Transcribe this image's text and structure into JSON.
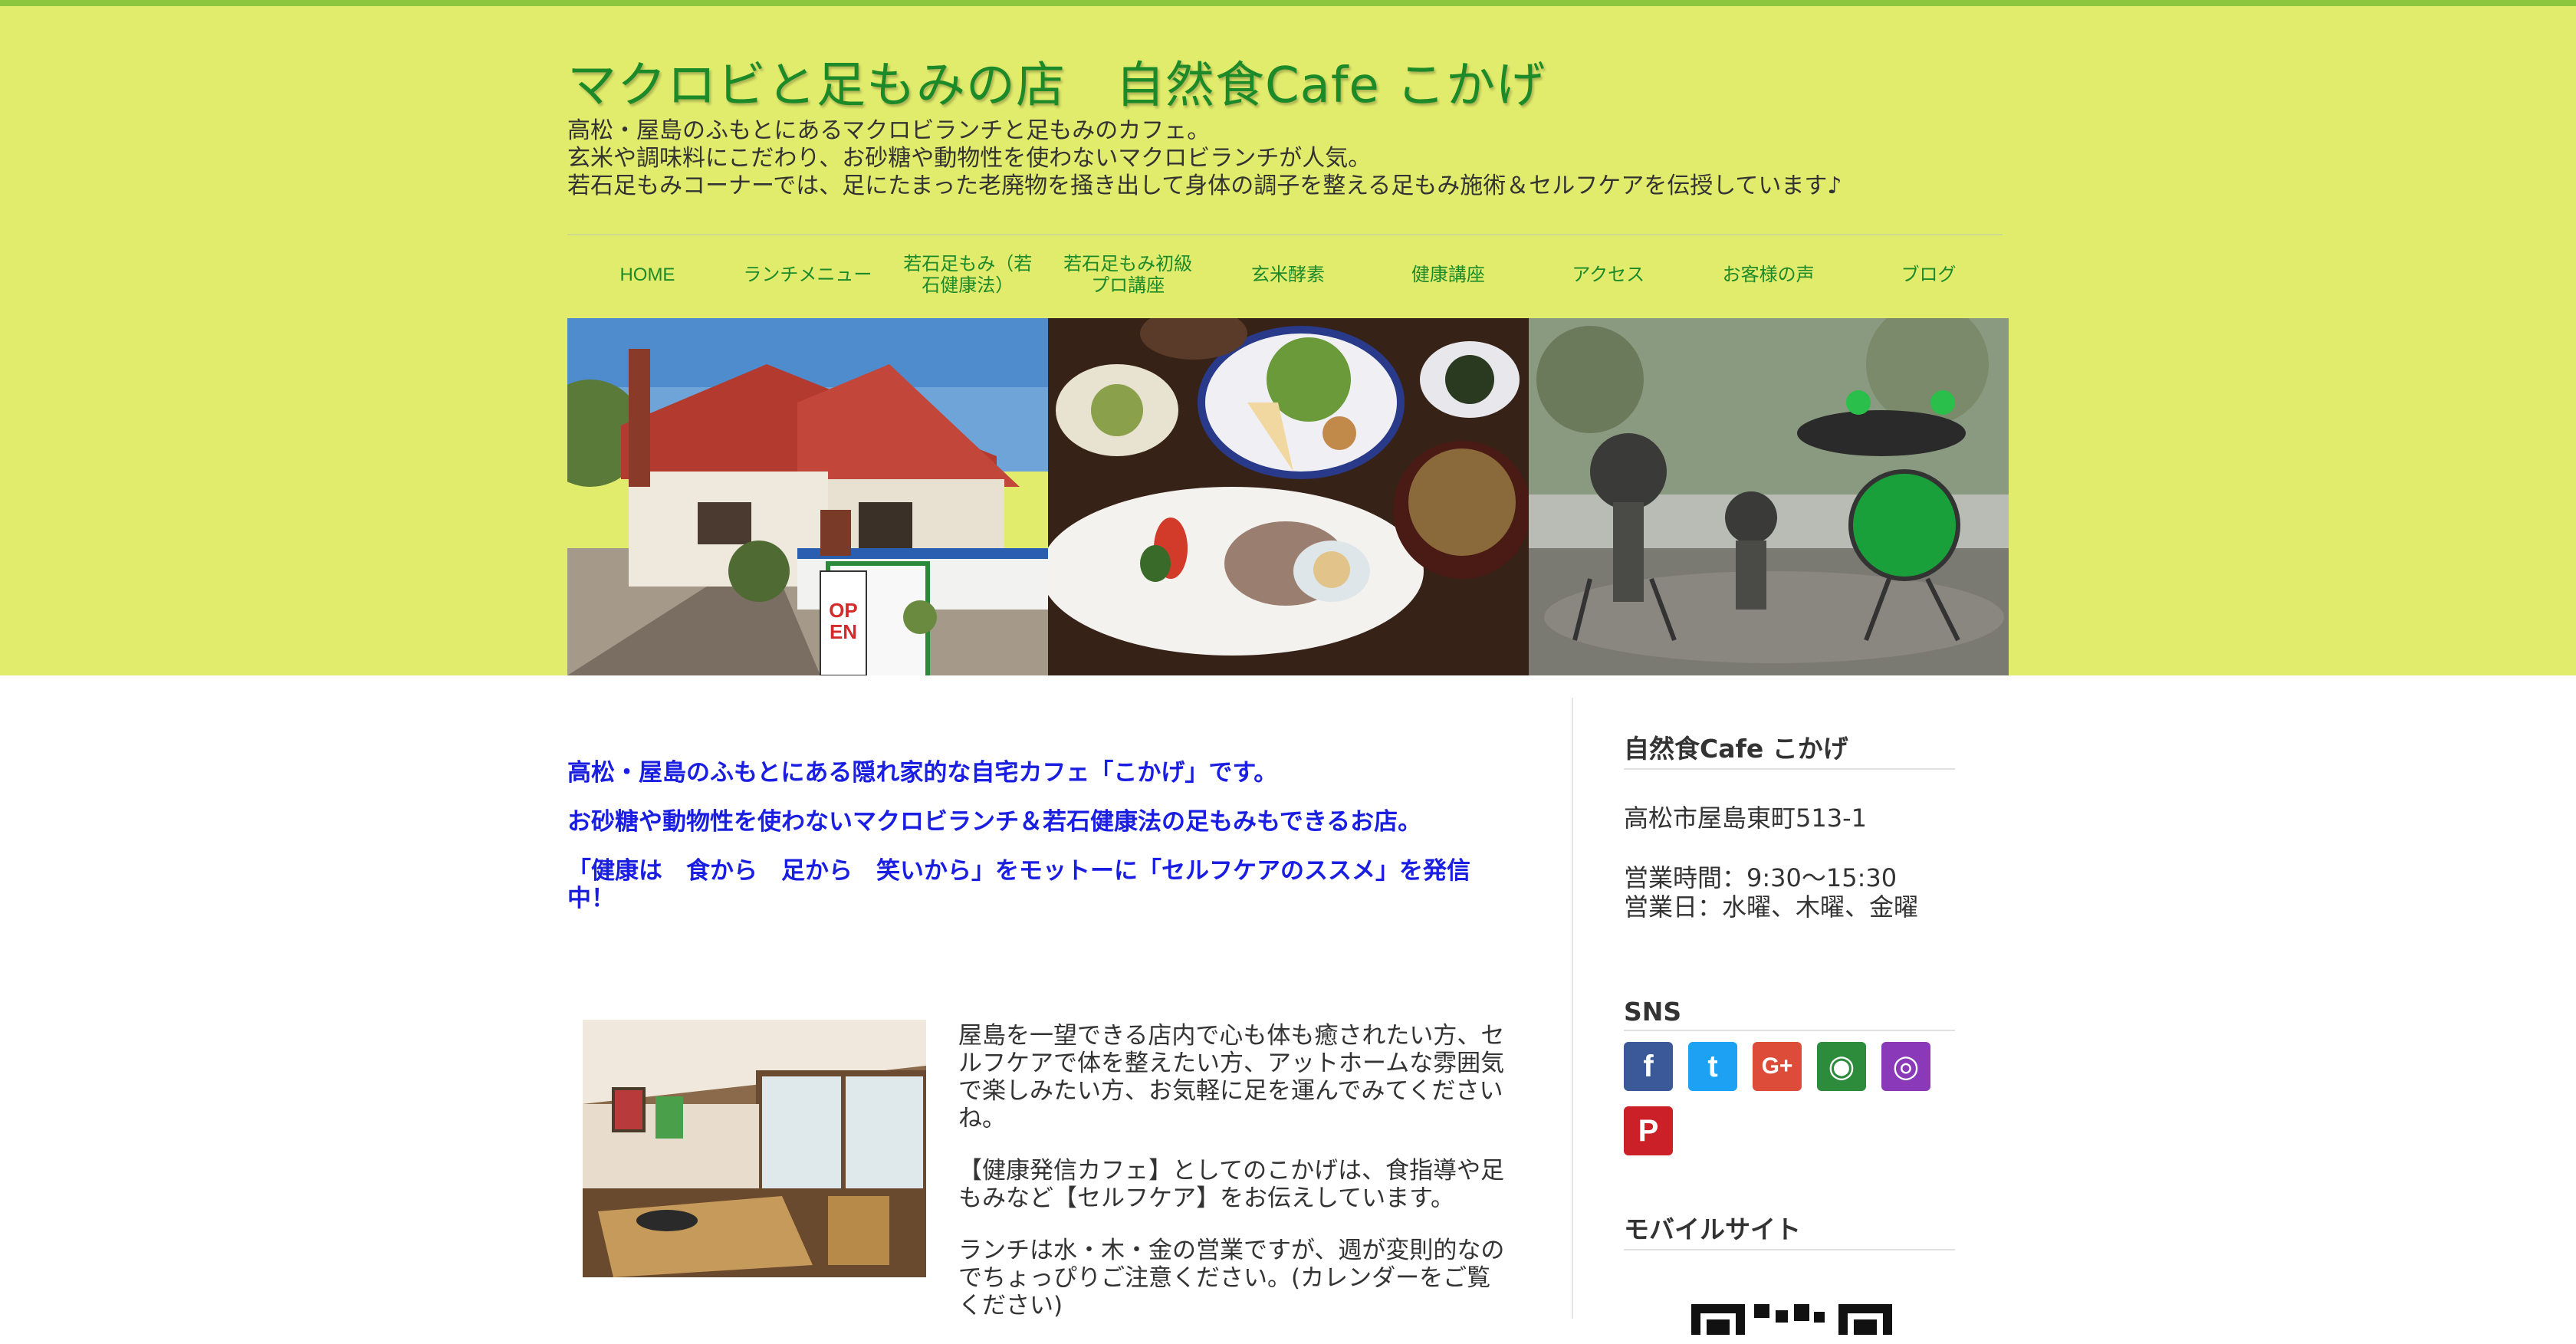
{
  "header": {
    "site_title": "マクロビと足もみの店　自然食Cafe こかげ",
    "tagline": [
      "高松・屋島のふもとにあるマクロビランチと足もみのカフェ。",
      "玄米や調味料にこだわり、お砂糖や動物性を使わないマクロビランチが人気。",
      "若石足もみコーナーでは、足にたまった老廃物を掻き出して身体の調子を整える足もみ施術＆セルフケアを伝授しています♪"
    ]
  },
  "nav": {
    "items": [
      {
        "label": "HOME"
      },
      {
        "label": "ランチメニュー"
      },
      {
        "label": "若石足もみ（若石健康法）"
      },
      {
        "label": "若石足もみ初級プロ講座"
      },
      {
        "label": "玄米酵素"
      },
      {
        "label": "健康講座"
      },
      {
        "label": "アクセス"
      },
      {
        "label": "お客様の声"
      },
      {
        "label": "ブログ"
      }
    ]
  },
  "main": {
    "intro": [
      "高松・屋島のふもとにある隠れ家的な自宅カフェ「こかげ」です。",
      "お砂糖や動物性を使わないマクロビランチ＆若石健康法の足もみもできるお店。",
      "「健康は　食から　足から　笑いから」をモットーに「セルフケアのススメ」を発信中！"
    ],
    "paragraphs": [
      "屋島を一望できる店内で心も体も癒されたい方、セルフケアで体を整えたい方、アットホームな雰囲気で楽しみたい方、お気軽に足を運んでみてくださいね。",
      "【健康発信カフェ】としてのこかげは、食指導や足もみなど【セルフケア】をお伝えしています。",
      "ランチは水・木・金の営業ですが、週が変則的なのでちょっぴりご注意ください。(カレンダーをご覧ください)"
    ]
  },
  "sidebar": {
    "shop_heading": "自然食Cafe こかげ",
    "address": "高松市屋島東町513-1",
    "hours": "営業時間：9:30〜15:30",
    "open_days": "営業日：水曜、木曜、金曜",
    "sns_heading": "SNS",
    "sns": [
      {
        "icon": "facebook-icon",
        "glyph": "f",
        "color": "#3b5998"
      },
      {
        "icon": "twitter-icon",
        "glyph": "t",
        "color": "#1da1f2"
      },
      {
        "icon": "google-plus-icon",
        "glyph": "G+",
        "color": "#dd4b39"
      },
      {
        "icon": "ameba-icon",
        "glyph": "◉",
        "color": "#2d8c3c"
      },
      {
        "icon": "instagram-icon",
        "glyph": "◎",
        "color": "#8a3ab9"
      },
      {
        "icon": "pinterest-icon",
        "glyph": "P",
        "color": "#cb2027"
      }
    ],
    "mobile_heading": "モバイルサイト"
  },
  "colors": {
    "header_bg": "#e2ec6c",
    "title_green": "#1d8a2a",
    "intro_blue": "#1a1ee0"
  }
}
